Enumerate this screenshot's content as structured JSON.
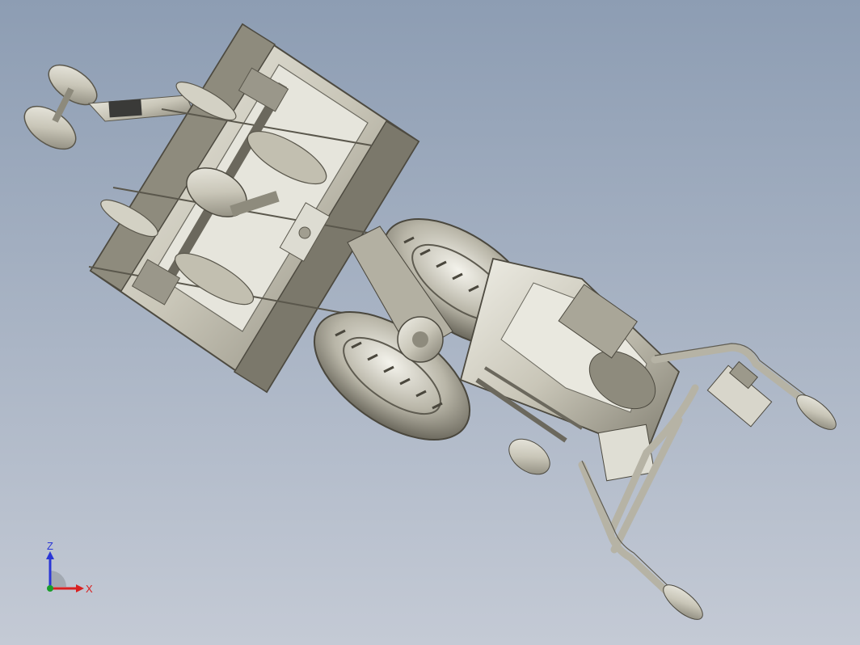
{
  "viewport": {
    "background_top": "#8d9db3",
    "background_bottom": "#c4cad5",
    "model_color": "#c9c6b8",
    "model_shadow": "#8d8a7c",
    "model_light": "#ecebe3"
  },
  "triad": {
    "z_label": "Z",
    "x_label": "X",
    "z_color": "#2a36d6",
    "x_color": "#d92020",
    "y_color": "#1a9e2a"
  }
}
